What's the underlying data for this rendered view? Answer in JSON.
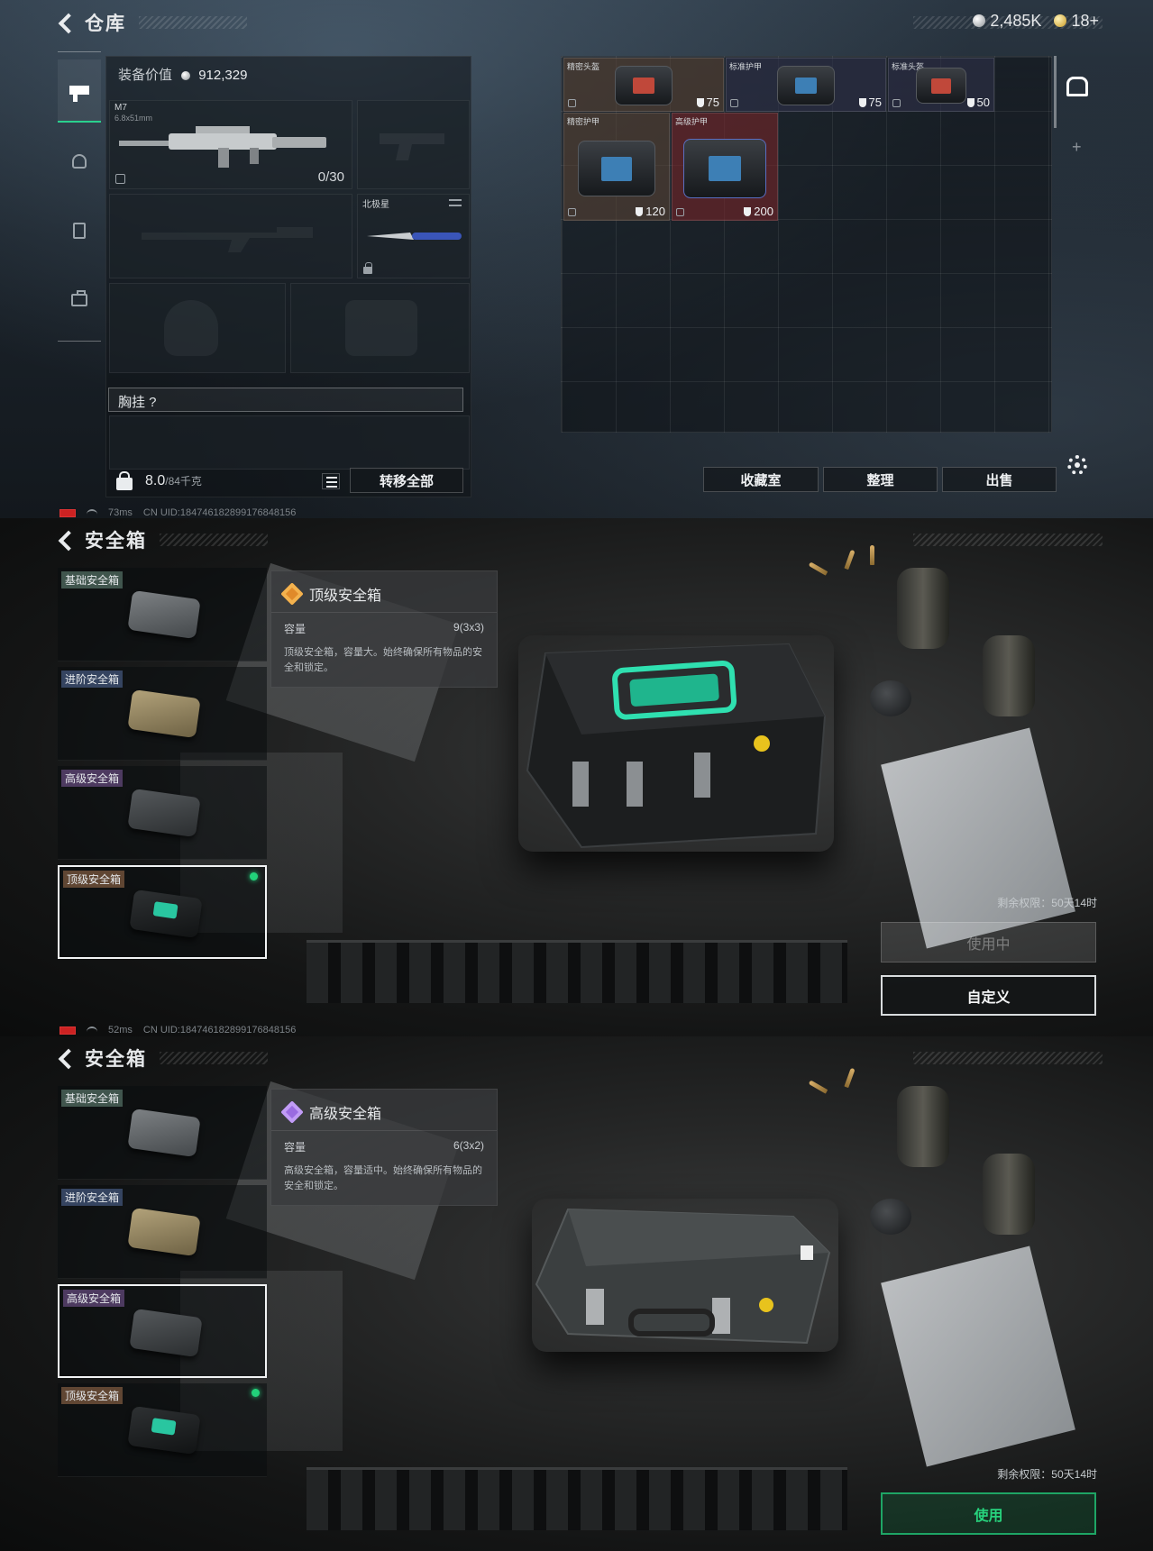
{
  "warehouse": {
    "title": "仓库",
    "currency_silver": "2,485K",
    "currency_gold": "18+",
    "rail_icons": [
      "gun-icon",
      "helmet-icon",
      "vest-icon",
      "bag-icon"
    ],
    "equip_value_label": "装备价值",
    "equip_value": "912,329",
    "primary_weapon": {
      "name": "M7",
      "caliber": "6.8x51mm",
      "ammo": "0/30"
    },
    "melee": {
      "name": "北极星"
    },
    "chest_rig_label": "胸挂 ?",
    "weight": "8.0",
    "weight_max": "/84千克",
    "transfer_all": "转移全部",
    "stash_items": [
      {
        "name": "精密头盔",
        "durability": "75"
      },
      {
        "name": "标准护甲",
        "durability": "75"
      },
      {
        "name": "标准头盔",
        "durability": "50"
      },
      {
        "name": "精密护甲",
        "durability": "120"
      },
      {
        "name": "高级护甲",
        "durability": "200"
      }
    ],
    "buttons": {
      "collection": "收藏室",
      "sort": "整理",
      "sell": "出售"
    },
    "status_ping": "73ms",
    "status_uid": "CN UID:18474618289917684815​6"
  },
  "safebox_top": {
    "title": "安全箱",
    "list": [
      {
        "tag": "基础安全箱"
      },
      {
        "tag": "进阶安全箱"
      },
      {
        "tag": "高级安全箱"
      },
      {
        "tag": "顶级安全箱"
      }
    ],
    "info": {
      "name": "顶级安全箱",
      "capacity_label": "容量",
      "capacity": "9(3x3)",
      "description": "顶级安全箱，容量大。始终确保所有物品的安全和锁定。"
    },
    "remain_label": "剩余权限：",
    "remain_value": "50天14时",
    "in_use": "使用中",
    "customize": "自定义",
    "status_ping": "52ms",
    "status_uid": "CN UID:18474618289917684815​6"
  },
  "safebox_adv": {
    "title": "安全箱",
    "list": [
      {
        "tag": "基础安全箱"
      },
      {
        "tag": "进阶安全箱"
      },
      {
        "tag": "高级安全箱"
      },
      {
        "tag": "顶级安全箱"
      }
    ],
    "info": {
      "name": "高级安全箱",
      "capacity_label": "容量",
      "capacity": "6(3x2)",
      "description": "高级安全箱，容量适中。始终确保所有物品的安全和锁定。"
    },
    "remain_label": "剩余权限：",
    "remain_value": "50天14时",
    "use": "使用"
  }
}
